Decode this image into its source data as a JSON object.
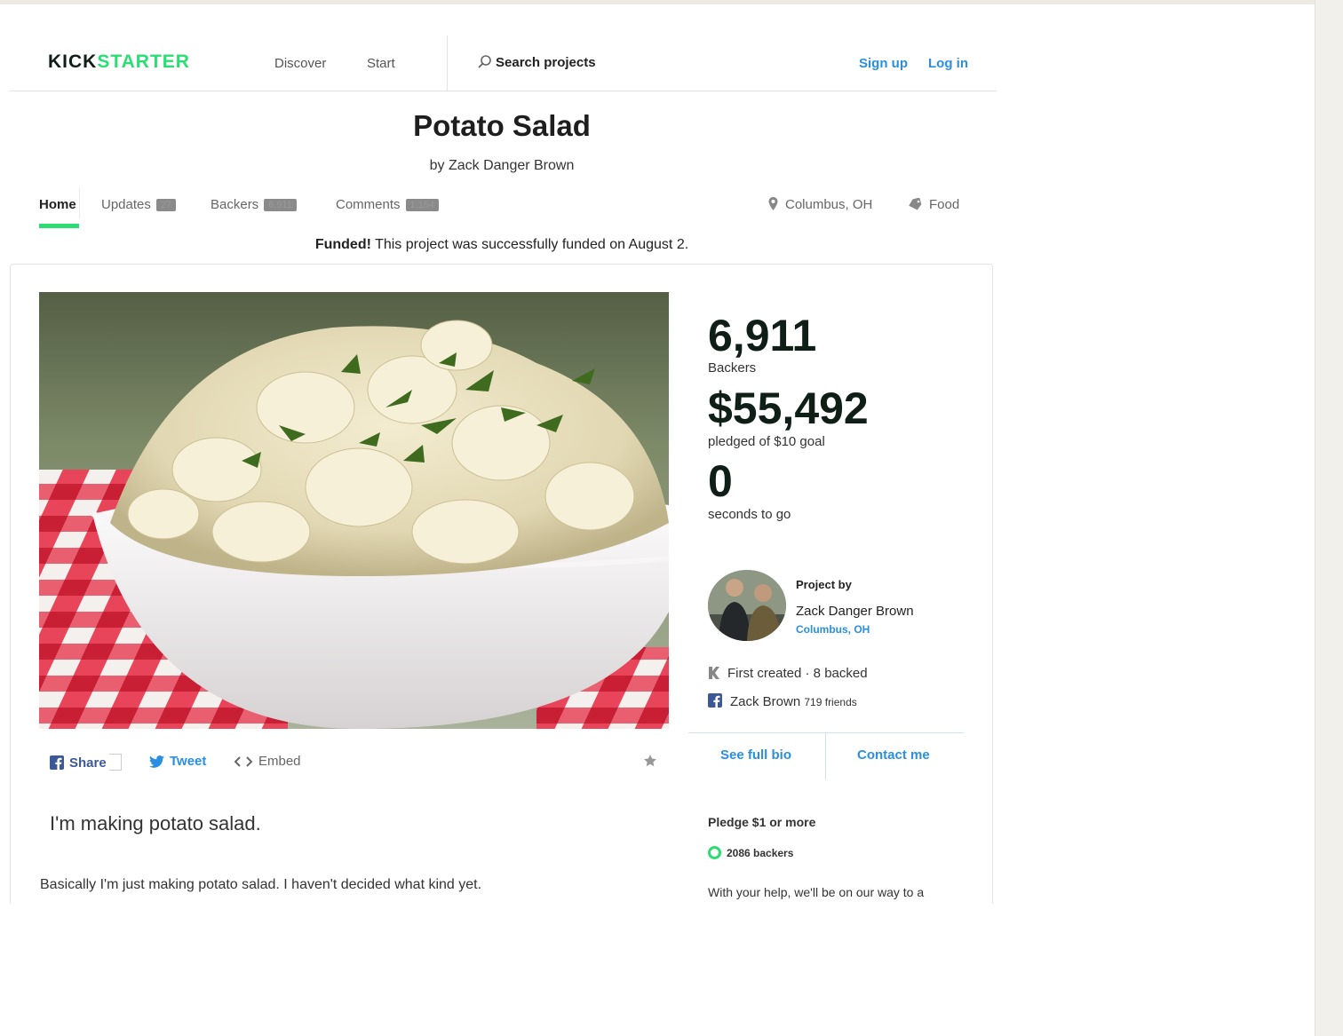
{
  "header": {
    "logo_left": "KICK",
    "logo_right": "STARTER",
    "nav": {
      "discover": "Discover",
      "start": "Start"
    },
    "search_label": "Search projects",
    "signup": "Sign up",
    "login": "Log in"
  },
  "project": {
    "title": "Potato Salad",
    "byline": "by Zack Danger Brown",
    "location": "Columbus, OH",
    "category": "Food"
  },
  "tabs": {
    "home": "Home",
    "updates": "Updates",
    "updates_count": "27",
    "backers": "Backers",
    "backers_count": "6,911",
    "comments": "Comments",
    "comments_count": "1,154"
  },
  "funded": {
    "strong": "Funded!",
    "text": " This project was successfully funded on August 2."
  },
  "share": {
    "share": "Share",
    "tweet": "Tweet",
    "embed": "Embed"
  },
  "content": {
    "blurb": "I'm making potato salad.",
    "description": "Basically I'm just making potato salad. I haven't decided what kind yet."
  },
  "stats": {
    "backers_value": "6,911",
    "backers_label": "Backers",
    "pledged_value": "$55,492",
    "pledged_label": "pledged of $10 goal",
    "time_value": "0",
    "time_label": "seconds to go"
  },
  "creator": {
    "project_by": "Project by",
    "name": "Zack Danger Brown",
    "location": "Columbus, OH",
    "ks_stats": "First created · 8 backed",
    "fb_name": "Zack Brown",
    "fb_friends": "719 friends",
    "see_bio": "See full bio",
    "contact": "Contact me"
  },
  "reward": {
    "pledge": "Pledge $1 or more",
    "backers": "2086 backers",
    "description": "With your help, we'll be on our way to a successful potato salad. You will get"
  },
  "colors": {
    "brand_green": "#2bde73",
    "link_blue": "#2a8fe0",
    "facebook_blue": "#3b5998"
  }
}
